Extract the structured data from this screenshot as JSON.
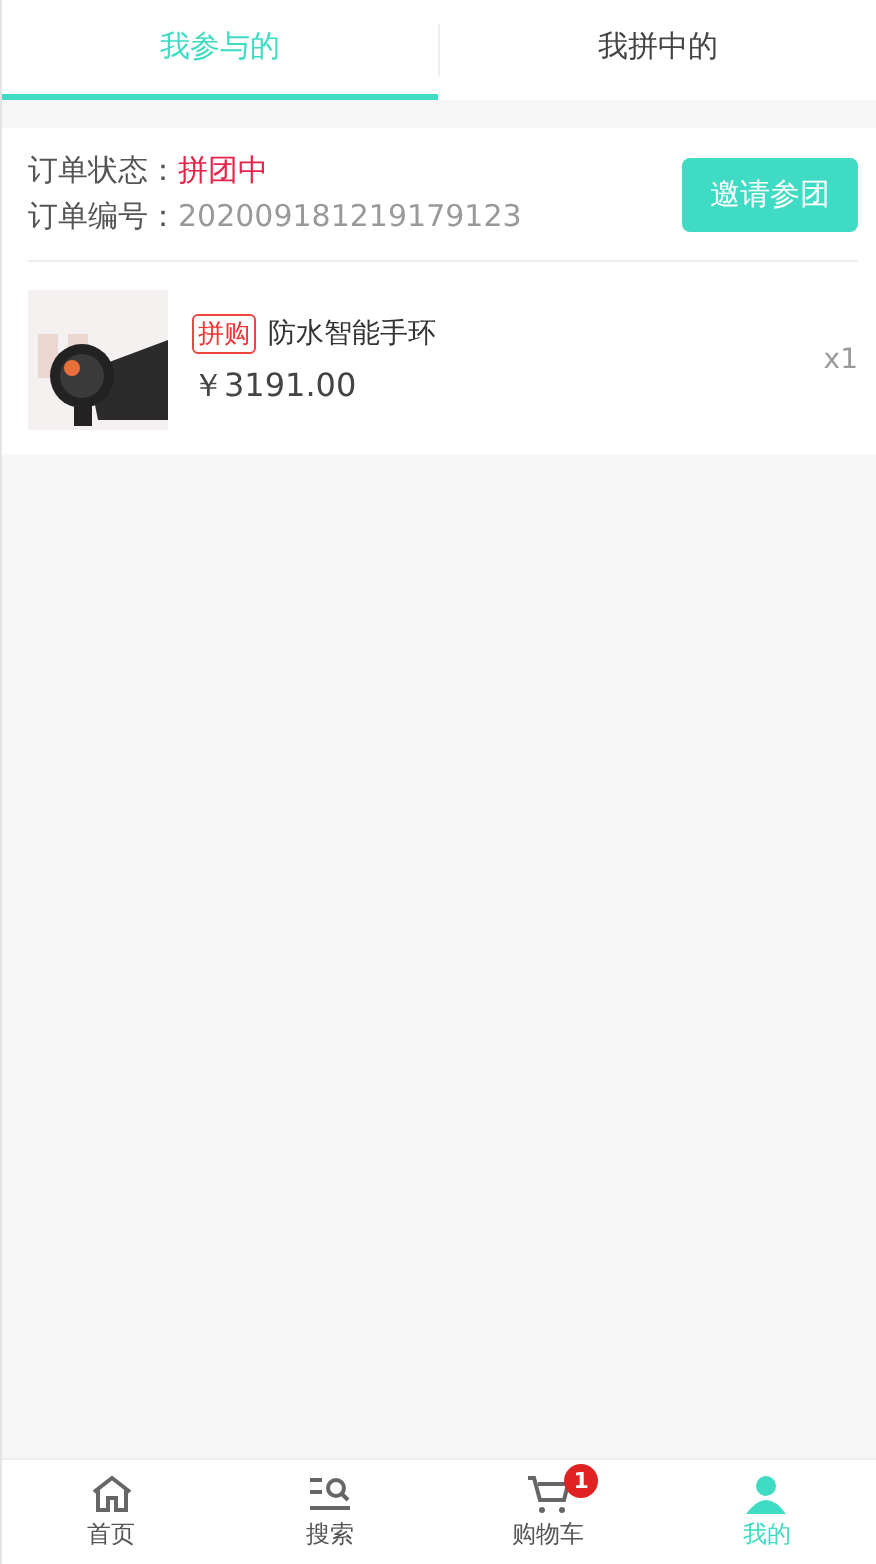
{
  "tabs": [
    {
      "label": "我参与的",
      "selected": true
    },
    {
      "label": "我拼中的",
      "selected": false
    }
  ],
  "orders": [
    {
      "status_label": "订单状态：",
      "status": "拼团中",
      "number_label": "订单编号：",
      "number": "202009181219179123",
      "action": "邀请参团",
      "items": [
        {
          "tag": "拼购",
          "name": "防水智能手环",
          "price": "￥3191.00",
          "quantity": "x1"
        }
      ]
    }
  ],
  "bottom_nav": [
    {
      "kind": "home",
      "label": "首页",
      "selected": false
    },
    {
      "kind": "search",
      "label": "搜索",
      "selected": false
    },
    {
      "kind": "cart",
      "label": "购物车",
      "selected": false,
      "badge": "1"
    },
    {
      "kind": "user",
      "label": "我的",
      "selected": true
    }
  ]
}
